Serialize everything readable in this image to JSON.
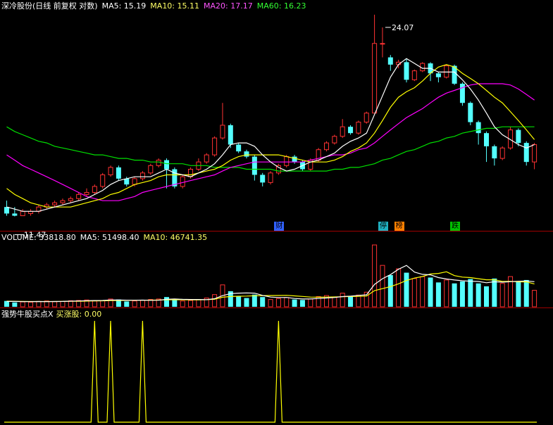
{
  "header": {
    "stock": "深冷股份(日线 前复权 对数)",
    "ma5": "MA5: 15.19",
    "ma10": "MA10: 15.11",
    "ma20": "MA20: 17.17",
    "ma60": "MA60: 16.23"
  },
  "vol_header": {
    "volume": "VOLUME: 33818.80",
    "ma5": "MA5: 51498.40",
    "ma10": "MA10: 46741.35"
  },
  "ind_header": {
    "name": "强势牛股买点X",
    "value": "买涨股: 0.00"
  },
  "price_labels": {
    "high": "24.07",
    "low": "11.47"
  },
  "event_tags": [
    {
      "text": "财",
      "index": 34
    },
    {
      "text": "停",
      "index": 47
    },
    {
      "text": "榜",
      "index": 49
    },
    {
      "text": "跌",
      "index": 56
    }
  ],
  "colors": {
    "up": "#ff3232",
    "down": "#54ffff",
    "ma5": "#ffffff",
    "ma10": "#ffff00",
    "ma20": "#ff00ff",
    "ma60": "#00e000",
    "indicator": "#ffff00",
    "header_ma10": "#ffff66",
    "header_ma20": "#ff55ff",
    "header_ma60": "#33ff33",
    "grid": "#a00000"
  },
  "chart_data": {
    "type": "candlestick",
    "price_ylim": [
      10.9,
      25.5
    ],
    "price_scale": "log",
    "candles": [
      [
        11.9,
        11.6,
        12.2,
        11.5
      ],
      [
        11.6,
        11.5,
        11.9,
        11.47
      ],
      [
        11.5,
        11.7,
        11.8,
        11.5
      ],
      [
        11.6,
        11.7,
        11.8,
        11.5
      ],
      [
        11.7,
        11.9,
        12.0,
        11.6
      ],
      [
        11.9,
        12.0,
        12.1,
        11.8
      ],
      [
        12.0,
        12.1,
        12.2,
        11.9
      ],
      [
        12.1,
        12.2,
        12.3,
        12.0
      ],
      [
        12.2,
        12.3,
        12.4,
        12.1
      ],
      [
        12.3,
        12.5,
        12.6,
        12.2
      ],
      [
        12.5,
        12.6,
        12.8,
        12.4
      ],
      [
        12.6,
        12.9,
        13.0,
        12.5
      ],
      [
        12.9,
        13.5,
        13.6,
        12.8
      ],
      [
        13.5,
        13.9,
        14.0,
        13.4
      ],
      [
        13.9,
        13.3,
        14.0,
        13.2
      ],
      [
        13.3,
        13.0,
        13.4,
        12.9
      ],
      [
        13.0,
        13.3,
        13.4,
        12.9
      ],
      [
        13.3,
        13.6,
        13.7,
        13.2
      ],
      [
        13.6,
        14.0,
        14.1,
        13.5
      ],
      [
        14.0,
        14.3,
        14.4,
        13.9
      ],
      [
        14.3,
        13.8,
        14.4,
        12.8
      ],
      [
        13.8,
        12.9,
        13.9,
        12.8
      ],
      [
        12.9,
        13.4,
        13.5,
        12.8
      ],
      [
        13.4,
        13.8,
        13.9,
        13.3
      ],
      [
        13.8,
        14.2,
        14.4,
        13.7
      ],
      [
        14.2,
        14.6,
        14.7,
        14.1
      ],
      [
        14.6,
        15.6,
        15.7,
        14.5
      ],
      [
        15.6,
        16.4,
        17.9,
        15.5
      ],
      [
        16.4,
        15.2,
        16.5,
        15.0
      ],
      [
        15.2,
        14.8,
        15.3,
        14.7
      ],
      [
        14.8,
        14.5,
        14.9,
        14.4
      ],
      [
        14.5,
        13.5,
        14.6,
        13.2
      ],
      [
        13.5,
        13.1,
        13.6,
        12.9
      ],
      [
        13.1,
        13.6,
        13.7,
        13.0
      ],
      [
        13.6,
        14.0,
        14.1,
        13.5
      ],
      [
        14.0,
        14.5,
        14.6,
        13.9
      ],
      [
        14.5,
        14.2,
        14.6,
        14.1
      ],
      [
        14.2,
        13.8,
        14.3,
        13.7
      ],
      [
        13.8,
        14.3,
        14.4,
        13.7
      ],
      [
        14.3,
        14.9,
        15.0,
        14.2
      ],
      [
        14.9,
        15.3,
        15.4,
        14.8
      ],
      [
        15.3,
        15.7,
        15.8,
        15.2
      ],
      [
        15.7,
        16.3,
        16.8,
        15.6
      ],
      [
        16.3,
        15.9,
        16.4,
        15.8
      ],
      [
        15.9,
        16.6,
        16.7,
        15.8
      ],
      [
        16.6,
        17.2,
        17.3,
        16.5
      ],
      [
        17.2,
        22.6,
        25.3,
        17.2
      ],
      [
        22.6,
        22.6,
        24.07,
        21.4
      ],
      [
        21.4,
        20.8,
        21.6,
        20.3
      ],
      [
        20.8,
        21.0,
        21.2,
        20.5
      ],
      [
        21.0,
        19.6,
        21.3,
        19.4
      ],
      [
        19.6,
        20.3,
        20.4,
        19.5
      ],
      [
        20.3,
        20.9,
        21.0,
        20.2
      ],
      [
        20.9,
        20.1,
        21.0,
        19.5
      ],
      [
        20.1,
        19.8,
        20.2,
        19.4
      ],
      [
        19.8,
        20.7,
        20.8,
        19.7
      ],
      [
        20.7,
        19.3,
        20.8,
        19.2
      ],
      [
        19.3,
        17.9,
        19.4,
        17.7
      ],
      [
        17.9,
        16.6,
        18.0,
        16.4
      ],
      [
        16.6,
        15.9,
        16.7,
        15.2
      ],
      [
        15.9,
        15.1,
        16.0,
        14.2
      ],
      [
        15.1,
        14.4,
        15.2,
        14.0
      ],
      [
        14.4,
        15.0,
        15.1,
        14.3
      ],
      [
        15.0,
        16.1,
        16.3,
        14.9
      ],
      [
        16.1,
        15.3,
        16.2,
        15.1
      ],
      [
        15.3,
        14.2,
        15.4,
        14.0
      ],
      [
        14.2,
        15.2,
        15.3,
        13.8
      ]
    ],
    "ma5": [
      11.9,
      11.8,
      11.7,
      11.7,
      11.7,
      11.8,
      11.9,
      12.0,
      12.1,
      12.2,
      12.3,
      12.5,
      12.7,
      13.0,
      13.2,
      13.3,
      13.4,
      13.4,
      13.4,
      13.6,
      13.8,
      13.6,
      13.5,
      13.4,
      13.6,
      13.8,
      14.1,
      14.6,
      15.2,
      15.3,
      15.3,
      15.1,
      14.6,
      14.2,
      13.9,
      13.7,
      13.8,
      14.0,
      14.2,
      14.3,
      14.5,
      14.7,
      15.1,
      15.4,
      15.6,
      15.9,
      17.1,
      18.4,
      19.8,
      20.8,
      21.3,
      20.9,
      20.5,
      20.5,
      20.2,
      20.2,
      20.2,
      19.6,
      18.9,
      18.1,
      17.2,
      16.3,
      15.8,
      15.5,
      15.2,
      15.0,
      15.2
    ],
    "ma10": [
      12.8,
      12.5,
      12.3,
      12.1,
      12.0,
      11.9,
      11.9,
      11.9,
      11.9,
      12.0,
      12.1,
      12.2,
      12.3,
      12.5,
      12.6,
      12.8,
      13.0,
      13.1,
      13.2,
      13.4,
      13.5,
      13.5,
      13.5,
      13.5,
      13.6,
      13.7,
      13.8,
      14.0,
      14.3,
      14.5,
      14.6,
      14.6,
      14.6,
      14.6,
      14.6,
      14.5,
      14.4,
      14.3,
      14.2,
      14.2,
      14.2,
      14.3,
      14.5,
      14.8,
      15.0,
      15.3,
      15.9,
      16.7,
      17.6,
      18.3,
      18.7,
      19.0,
      19.5,
      20.1,
      20.6,
      20.8,
      20.6,
      20.1,
      19.7,
      19.3,
      18.8,
      18.3,
      17.9,
      17.3,
      16.7,
      16.1,
      15.5
    ],
    "ma20": [
      14.6,
      14.3,
      14.0,
      13.8,
      13.6,
      13.4,
      13.2,
      13.0,
      12.8,
      12.6,
      12.4,
      12.3,
      12.2,
      12.2,
      12.2,
      12.3,
      12.4,
      12.6,
      12.7,
      12.8,
      12.9,
      13.0,
      13.1,
      13.2,
      13.3,
      13.4,
      13.5,
      13.7,
      13.9,
      14.0,
      14.1,
      14.2,
      14.2,
      14.2,
      14.2,
      14.2,
      14.2,
      14.2,
      14.3,
      14.4,
      14.5,
      14.6,
      14.6,
      14.7,
      14.9,
      15.0,
      15.3,
      15.7,
      16.1,
      16.5,
      16.9,
      17.2,
      17.5,
      17.9,
      18.3,
      18.6,
      18.8,
      19.0,
      19.2,
      19.3,
      19.3,
      19.3,
      19.3,
      19.2,
      18.9,
      18.5,
      18.1
    ],
    "ma60": [
      16.3,
      16.0,
      15.8,
      15.6,
      15.4,
      15.3,
      15.1,
      15.0,
      14.9,
      14.8,
      14.7,
      14.6,
      14.6,
      14.5,
      14.4,
      14.4,
      14.3,
      14.3,
      14.2,
      14.2,
      14.1,
      14.1,
      14.1,
      14.0,
      14.0,
      14.0,
      13.9,
      13.9,
      13.9,
      13.9,
      13.8,
      13.8,
      13.8,
      13.8,
      13.7,
      13.7,
      13.7,
      13.7,
      13.7,
      13.7,
      13.7,
      13.8,
      13.8,
      13.9,
      13.9,
      14.0,
      14.1,
      14.3,
      14.4,
      14.6,
      14.8,
      14.9,
      15.1,
      15.3,
      15.4,
      15.6,
      15.7,
      15.9,
      16.0,
      16.1,
      16.2,
      16.2,
      16.3,
      16.3,
      16.3,
      16.3,
      16.3
    ],
    "volume": [
      12000,
      9000,
      10000,
      9500,
      11000,
      12000,
      10500,
      11000,
      12500,
      13000,
      14000,
      12000,
      13000,
      16000,
      15000,
      11000,
      12000,
      13500,
      15000,
      16000,
      20000,
      15000,
      12000,
      13000,
      15000,
      18000,
      25000,
      45000,
      32000,
      22000,
      18000,
      25000,
      20000,
      15000,
      17000,
      19000,
      15000,
      14000,
      16000,
      21000,
      23000,
      20000,
      28000,
      22000,
      24000,
      30000,
      127000,
      85000,
      65000,
      78000,
      70000,
      58000,
      62000,
      60000,
      50000,
      55000,
      48000,
      52000,
      57000,
      48000,
      42000,
      58000,
      48000,
      62000,
      52000,
      55000,
      33818.8
    ],
    "vol_ylim": [
      0,
      130000
    ],
    "vol_ma5": [
      11000,
      11000,
      10500,
      10500,
      10800,
      10600,
      10800,
      11000,
      11500,
      12000,
      12600,
      12900,
      13000,
      13800,
      14000,
      13600,
      13400,
      13700,
      13300,
      13500,
      15300,
      16000,
      15300,
      15000,
      15000,
      14600,
      16600,
      23000,
      27000,
      28000,
      28400,
      28000,
      23400,
      20000,
      19000,
      19200,
      17000,
      16000,
      16000,
      17000,
      18000,
      19000,
      21000,
      22000,
      23400,
      24600,
      46000,
      57600,
      66000,
      77000,
      85000,
      71200,
      66600,
      65600,
      60000,
      57000,
      55000,
      53400,
      52400,
      52000,
      49400,
      51400,
      50600,
      51600,
      52400,
      53000,
      51498.4
    ],
    "vol_ma10": [
      11500,
      11300,
      11000,
      10800,
      10800,
      10800,
      10900,
      11000,
      11200,
      11300,
      11700,
      12000,
      12300,
      12700,
      13000,
      13100,
      13400,
      13500,
      13700,
      13800,
      14400,
      14500,
      14500,
      14300,
      14300,
      14600,
      15500,
      19600,
      21100,
      21700,
      21900,
      22700,
      23000,
      23100,
      23200,
      23500,
      22400,
      21200,
      20000,
      19700,
      20000,
      20200,
      20700,
      21100,
      21400,
      21900,
      33200,
      37300,
      41400,
      47100,
      54000,
      58900,
      62100,
      67300,
      68500,
      72000,
      64000,
      61000,
      60000,
      57600,
      55400,
      55500,
      52000,
      52200,
      51300,
      51100,
      46741.35
    ],
    "indicator": [
      0,
      0,
      0,
      0,
      0,
      0,
      0,
      0,
      0,
      0,
      0,
      0,
      0,
      0,
      0,
      0,
      0,
      0,
      0,
      0,
      0,
      0,
      0,
      0,
      0,
      0,
      0,
      0,
      0,
      0,
      0,
      0,
      0,
      0,
      0,
      0,
      0,
      0,
      0,
      0,
      0,
      0,
      0,
      0,
      0,
      0,
      0,
      0,
      0,
      0,
      0,
      0,
      0,
      0,
      0,
      0,
      0,
      0,
      0,
      0,
      0,
      0,
      0,
      0,
      0,
      0,
      0
    ],
    "indicator_peaks": [
      11,
      13,
      17,
      34
    ],
    "indicator_ylim": [
      0,
      1
    ]
  }
}
